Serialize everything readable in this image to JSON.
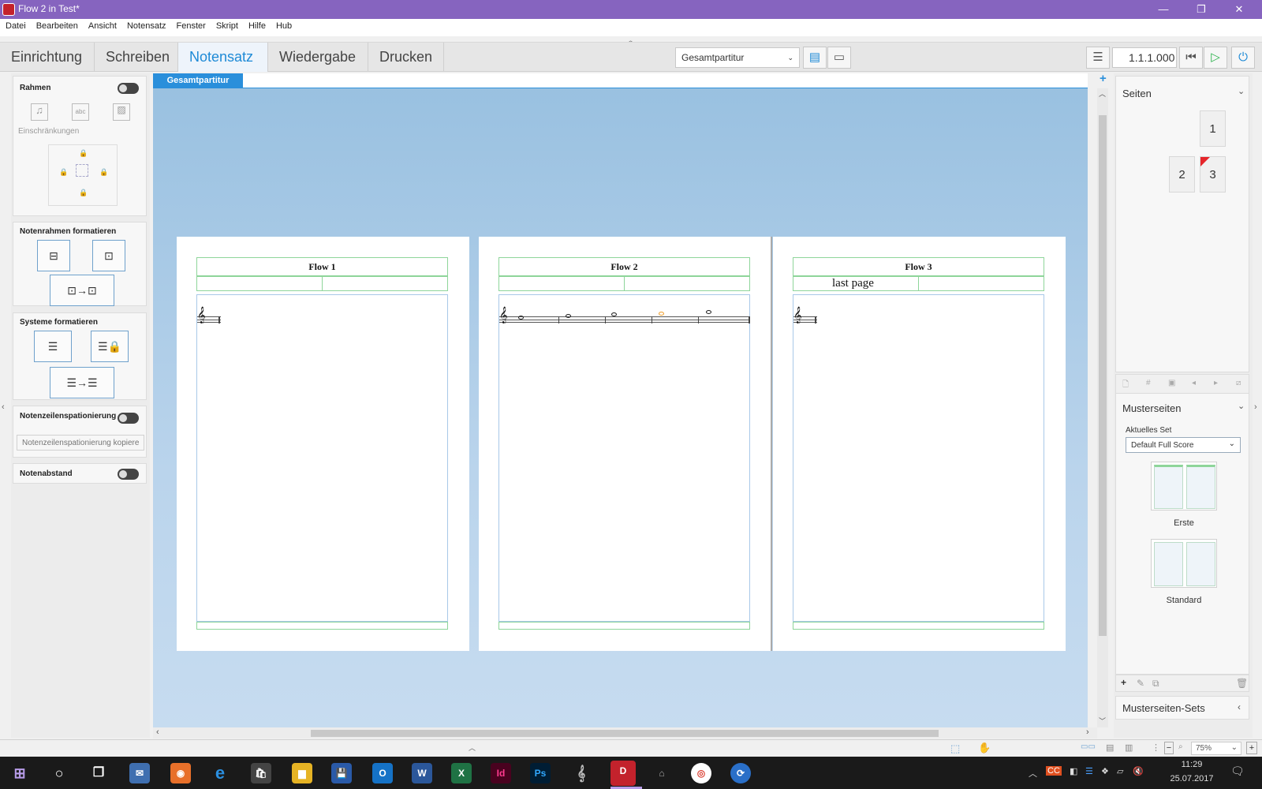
{
  "window": {
    "title": "Flow 2 in Test*",
    "minimize": "—",
    "restore": "❐",
    "close": "✕"
  },
  "menu": [
    "Datei",
    "Bearbeiten",
    "Ansicht",
    "Notensatz",
    "Fenster",
    "Skript",
    "Hilfe",
    "Hub"
  ],
  "modes": [
    "Einrichtung",
    "Schreiben",
    "Notensatz",
    "Wiedergabe",
    "Drucken"
  ],
  "active_mode": "Notensatz",
  "toolbar": {
    "layout_select": "Gesamtpartitur",
    "position": "1.1.1.000"
  },
  "doc_tab": "Gesamtpartitur",
  "left_panel": {
    "rahmen": {
      "title": "Rahmen",
      "abc": "abc",
      "constraints": "Einschränkungen"
    },
    "notenrahmen": "Notenrahmen formatieren",
    "systeme": "Systeme formatieren",
    "spacing": {
      "title": "Notenzeilenspationierung",
      "copy_placeholder": "Notenzeilenspationierung kopiere"
    },
    "notenabstand": "Notenabstand"
  },
  "pages": [
    {
      "flow": "Flow 1",
      "header_text": ""
    },
    {
      "flow": "Flow 2",
      "header_text": ""
    },
    {
      "flow": "Flow 3",
      "header_text": "last page"
    }
  ],
  "right_panel": {
    "seiten": {
      "title": "Seiten",
      "pages": [
        "1",
        "2",
        "3"
      ]
    },
    "musterseiten": {
      "title": "Musterseiten",
      "set_label": "Aktuelles Set",
      "set_value": "Default Full Score",
      "masters": [
        "Erste",
        "Standard"
      ]
    },
    "sets_title": "Musterseiten-Sets"
  },
  "status": {
    "zoom": "75%"
  },
  "taskbar": {
    "time": "11:29",
    "date": "25.07.2017"
  }
}
